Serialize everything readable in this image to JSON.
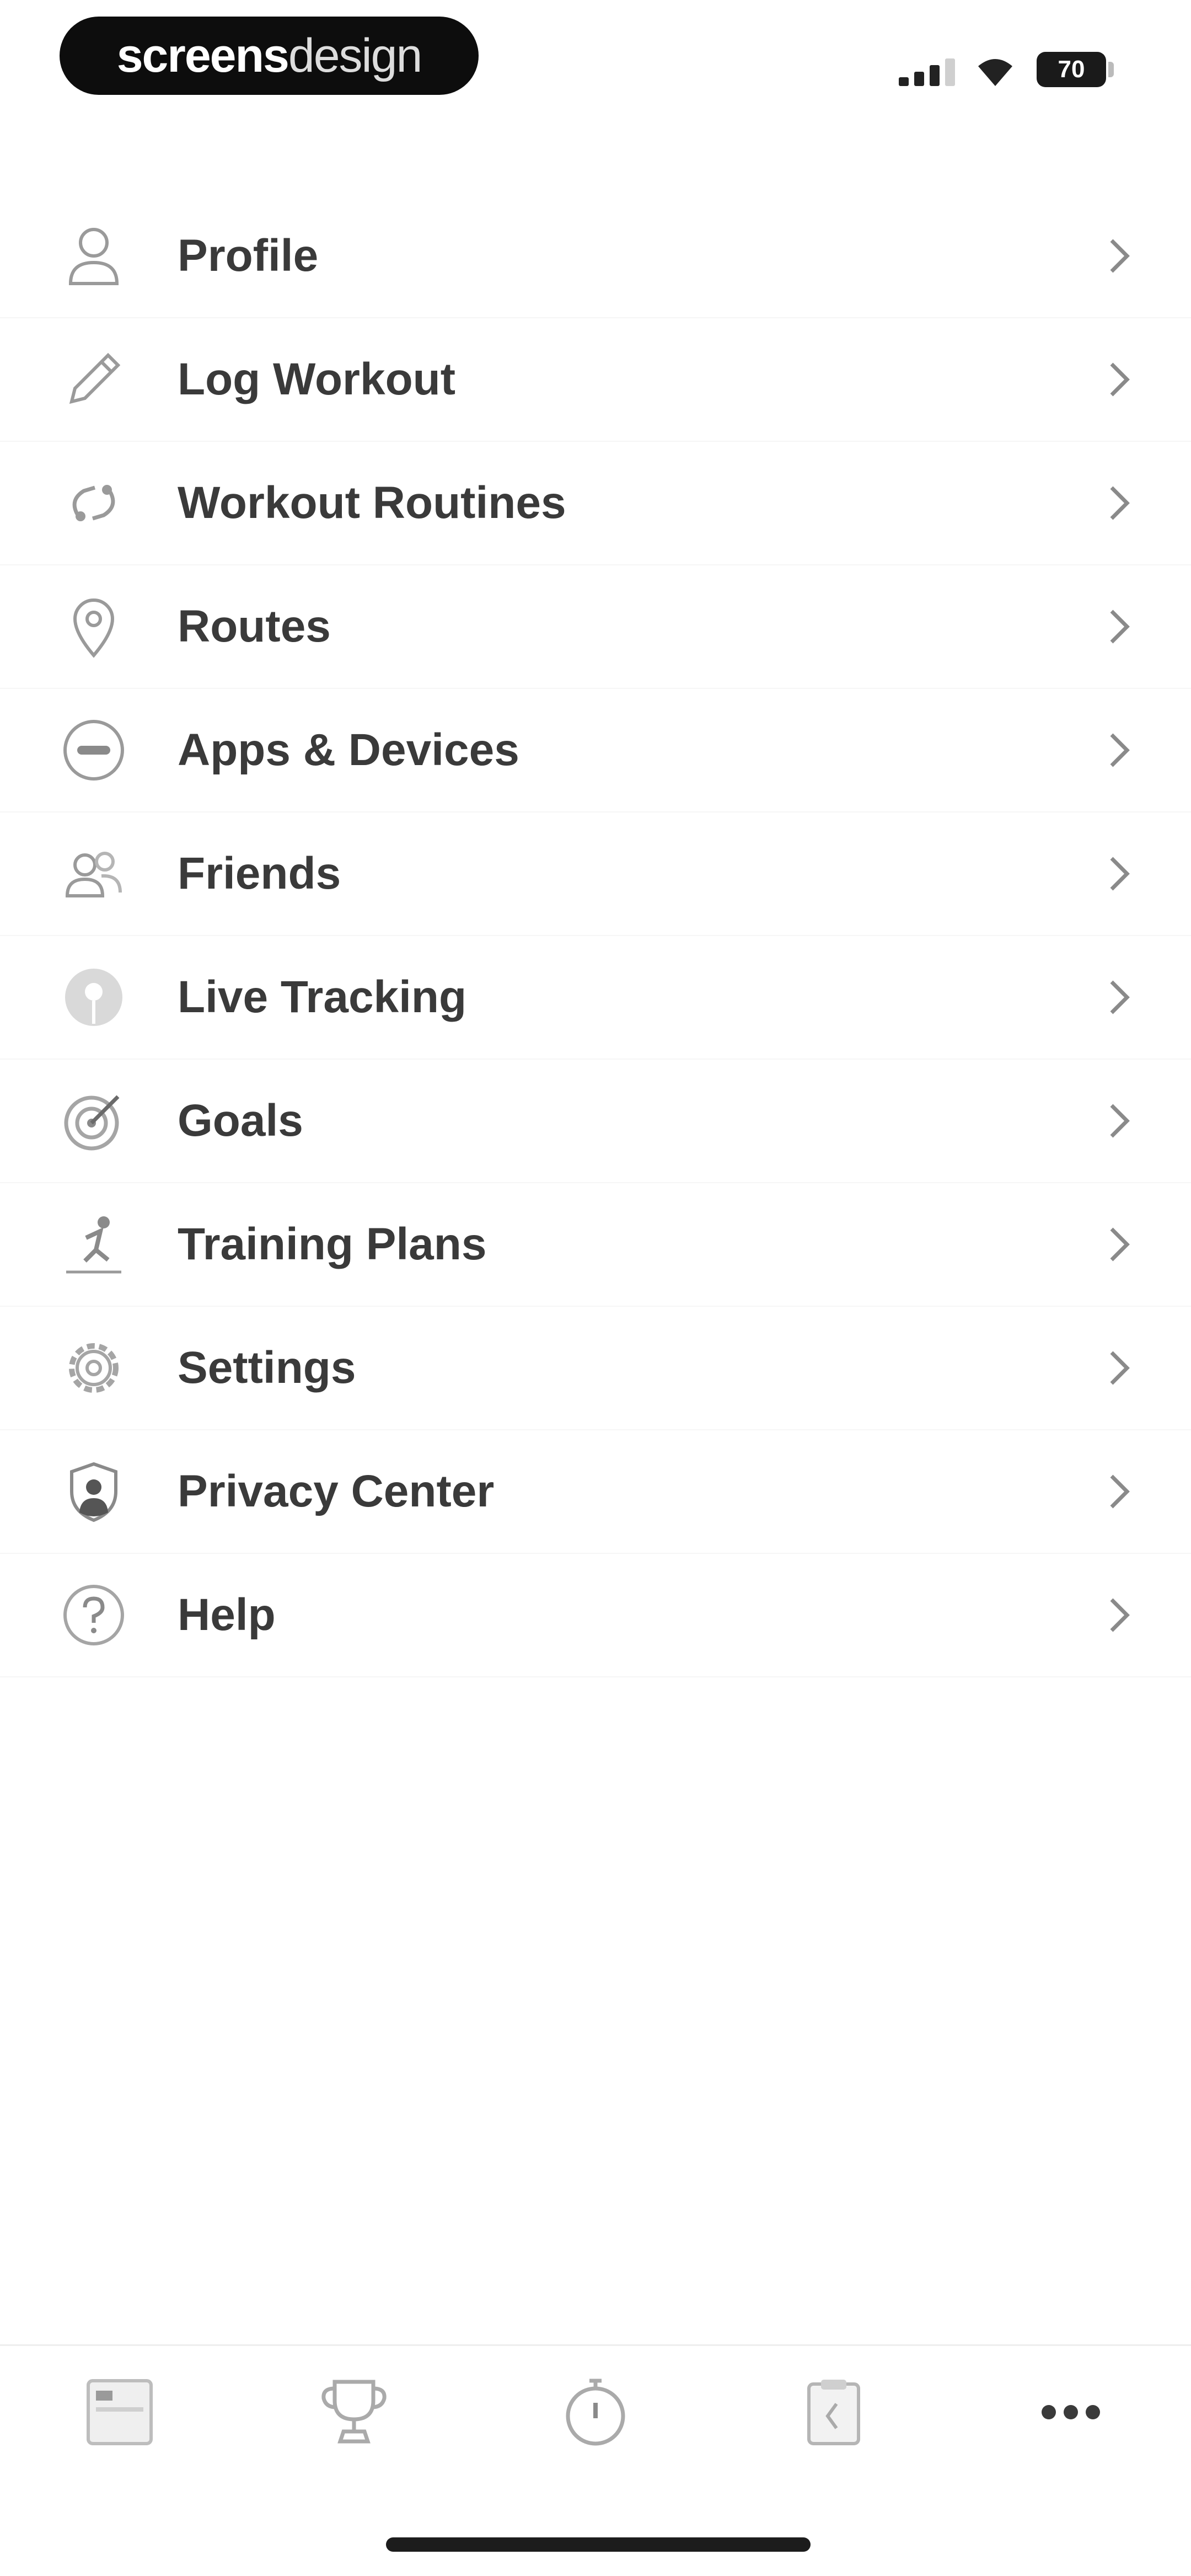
{
  "status_bar": {
    "brand_bold": "screens",
    "brand_light": "design",
    "battery": "70"
  },
  "menu": {
    "items": [
      {
        "label": "Profile",
        "icon": "person-icon"
      },
      {
        "label": "Log Workout",
        "icon": "pencil-icon"
      },
      {
        "label": "Workout Routines",
        "icon": "routines-icon"
      },
      {
        "label": "Routes",
        "icon": "map-pin-icon"
      },
      {
        "label": "Apps & Devices",
        "icon": "devices-icon"
      },
      {
        "label": "Friends",
        "icon": "friends-icon"
      },
      {
        "label": "Live Tracking",
        "icon": "live-tracking-icon"
      },
      {
        "label": "Goals",
        "icon": "target-icon"
      },
      {
        "label": "Training Plans",
        "icon": "runner-icon"
      },
      {
        "label": "Settings",
        "icon": "gear-icon"
      },
      {
        "label": "Privacy Center",
        "icon": "shield-person-icon"
      },
      {
        "label": "Help",
        "icon": "help-icon"
      }
    ]
  },
  "tab_bar": {
    "tabs": [
      {
        "icon": "feed-icon"
      },
      {
        "icon": "trophy-icon"
      },
      {
        "icon": "stopwatch-icon"
      },
      {
        "icon": "clipboard-icon"
      },
      {
        "icon": "more-icon"
      }
    ]
  },
  "colors": {
    "text": "#3a3a3a",
    "icon": "#9a9a9a",
    "background": "#ffffff",
    "brand_pill": "#0d0d0d"
  }
}
